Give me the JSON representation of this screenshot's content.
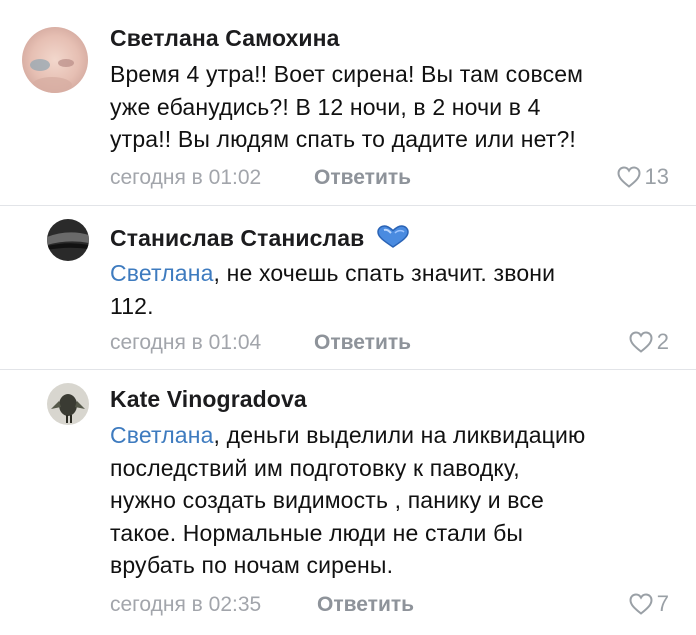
{
  "comments": [
    {
      "author": "Светлана Самохина",
      "text_lines": [
        "Время 4 утра!! Воет сирена! Вы там совсем",
        "уже ебанудись?! В 12 ночи, в 2 ночи в 4",
        "утра!! Вы людям спать то дадите или нет?!"
      ],
      "time": "сегодня в 01:02",
      "reply_label": "Ответить",
      "likes": "13"
    },
    {
      "author": "Станислав Станислав",
      "mention": "Светлана",
      "text_first_rest": ", не хочешь спать значит. звони",
      "text_lines_more": [
        "112."
      ],
      "time": "сегодня в 01:04",
      "reply_label": "Ответить",
      "likes": "2"
    },
    {
      "author": "Kate Vinogradova",
      "mention": "Светлана",
      "text_first_rest": ", деньги выделили на ликвидацию",
      "text_lines_more": [
        "последствий им подготовку к паводку,",
        "нужно создать видимость , панику и все",
        "такое. Нормальные люди не стали бы",
        "врубать по ночам сирены."
      ],
      "time": "сегодня в 02:35",
      "reply_label": "Ответить",
      "likes": "7"
    }
  ],
  "icons": {
    "like": "heart-outline-icon",
    "badge": "blue-heart-sticker-icon"
  },
  "colors": {
    "mention": "#3e7bbf",
    "meta": "#a2a5ab",
    "divider": "#e2e4e8"
  }
}
